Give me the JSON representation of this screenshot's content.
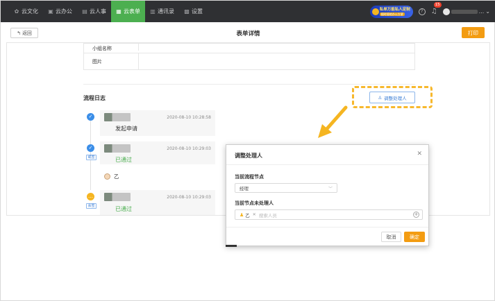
{
  "nav": {
    "items": [
      {
        "icon": "gear-icon",
        "label": "云文化",
        "active": false
      },
      {
        "icon": "briefcase-icon",
        "label": "云办公",
        "active": false
      },
      {
        "icon": "people-icon",
        "label": "云人事",
        "active": false
      },
      {
        "icon": "form-icon",
        "label": "云表单",
        "active": true
      },
      {
        "icon": "contacts-icon",
        "label": "通讯录",
        "active": false
      },
      {
        "icon": "grid-icon",
        "label": "设置",
        "active": false
      }
    ],
    "promo_line1": "私单万能私人定制",
    "promo_line2": "随时随地办公方便",
    "notification_count": "15",
    "user_suffix": "..."
  },
  "header": {
    "back_label": "返回",
    "title": "表单详情",
    "print_label": "打印"
  },
  "form": {
    "rows": [
      {
        "label": "小组名称"
      },
      {
        "label": "图片"
      }
    ]
  },
  "log": {
    "title": "流程日志",
    "adjust_label": "调整处理人",
    "items": [
      {
        "time": "2020-08-10 10:28:58",
        "status": "发起申请",
        "tag": ""
      },
      {
        "time": "2020-08-10 10:29:03",
        "status": "已通过",
        "tag": "或签",
        "sub_user": "乙"
      },
      {
        "time": "2020-08-10 10:29:03",
        "status": "已通过",
        "tag": "会签"
      }
    ]
  },
  "modal": {
    "title": "调整处理人",
    "node_label": "当前流程节点",
    "node_value": "经理",
    "handler_label": "当前节点未处理人",
    "chip_user": "乙",
    "search_placeholder": "搜索人员",
    "cancel_label": "取消",
    "ok_label": "确定"
  },
  "colors": {
    "nav_bg": "#2f3033",
    "active_tab": "#4caf50",
    "accent_orange": "#f39c12",
    "link_blue": "#3d7fd6",
    "highlight_yellow": "#f7b82d"
  }
}
